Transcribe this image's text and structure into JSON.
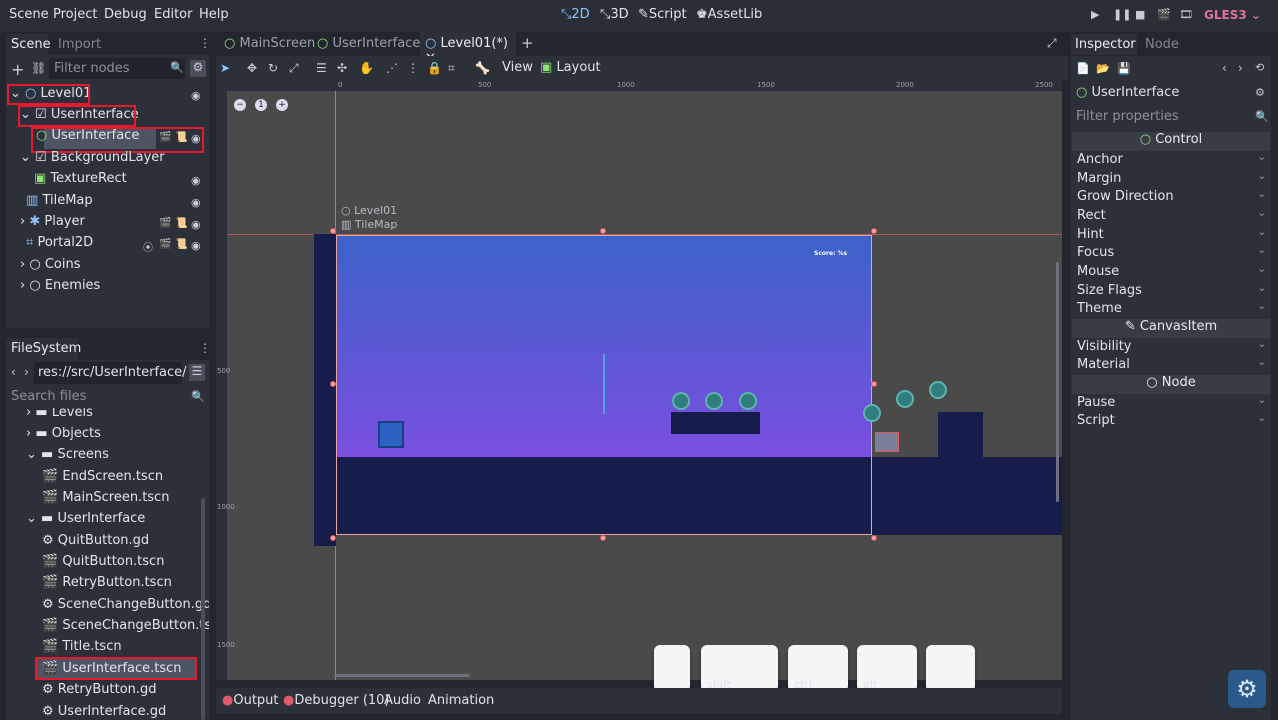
{
  "menu": {
    "scene": "Scene",
    "project": "Project",
    "debug": "Debug",
    "editor": "Editor",
    "help": "Help"
  },
  "workspaces": {
    "two_d": "2D",
    "three_d": "3D",
    "script": "Script",
    "assetlib": "AssetLib"
  },
  "renderer": "GLES3",
  "scene_dock": {
    "tab_scene": "Scene",
    "tab_import": "Import",
    "filter_placeholder": "Filter nodes",
    "nodes": [
      {
        "label": "Level01"
      },
      {
        "label": "UserInterface"
      },
      {
        "label": "UserInterface"
      },
      {
        "label": "BackgroundLayer"
      },
      {
        "label": "TextureRect"
      },
      {
        "label": "TileMap"
      },
      {
        "label": "Player"
      },
      {
        "label": "Portal2D"
      },
      {
        "label": "Coins"
      },
      {
        "label": "Enemies"
      }
    ]
  },
  "filesystem": {
    "title": "FileSystem",
    "path": "res://src/UserInterface/",
    "search_placeholder": "Search files",
    "items": [
      {
        "label": "Levels"
      },
      {
        "label": "Objects"
      },
      {
        "label": "Screens"
      },
      {
        "label": "EndScreen.tscn"
      },
      {
        "label": "MainScreen.tscn"
      },
      {
        "label": "UserInterface"
      },
      {
        "label": "QuitButton.gd"
      },
      {
        "label": "QuitButton.tscn"
      },
      {
        "label": "RetryButton.tscn"
      },
      {
        "label": "SceneChangeButton.gd"
      },
      {
        "label": "SceneChangeButton.tsc"
      },
      {
        "label": "Title.tscn"
      },
      {
        "label": "UserInterface.tscn"
      },
      {
        "label": "RetryButton.gd"
      },
      {
        "label": "UserInterface.gd"
      }
    ]
  },
  "editor_tabs": [
    "MainScreen",
    "UserInterface",
    "Level01(*)"
  ],
  "toolbar": {
    "view": "View",
    "layout": "Layout"
  },
  "ruler": {
    "ticks": [
      "0",
      "500",
      "1000",
      "1500",
      "2000",
      "2500"
    ],
    "vticks": [
      "500",
      "1000",
      "1500"
    ]
  },
  "viewport": {
    "label_level": "Level01",
    "label_tilemap": "TileMap",
    "score": "Score: %s"
  },
  "bottom_tabs": {
    "output": "Output",
    "debugger": "Debugger (10)",
    "audio": "Audio",
    "animation": "Animation"
  },
  "keys": {
    "shift": "shift",
    "ctrl": "ctrl",
    "alt": "alt"
  },
  "inspector": {
    "tab_inspector": "Inspector",
    "tab_node": "Node",
    "object": "UserInterface",
    "filter_placeholder": "Filter properties",
    "sections": {
      "control": "Control",
      "canvas_item": "CanvasItem",
      "node": "Node"
    },
    "control_props": [
      "Anchor",
      "Margin",
      "Grow Direction",
      "Rect",
      "Hint",
      "Focus",
      "Mouse",
      "Size Flags",
      "Theme"
    ],
    "canvas_props": [
      "Visibility",
      "Material"
    ],
    "node_props": [
      "Pause",
      "Script"
    ]
  },
  "colors": {
    "highlight": "#e8192e",
    "accent": "#8fc2ff",
    "sky_top": "#3c62c8",
    "sky_bottom": "#7a4fe0",
    "ground": "#161d4a"
  }
}
